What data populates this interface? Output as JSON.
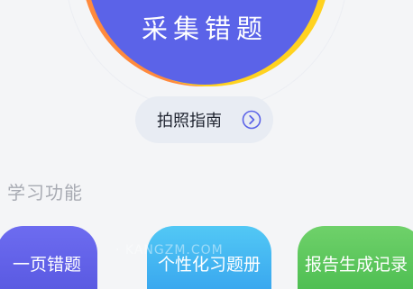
{
  "capture": {
    "label": "采集错题"
  },
  "guide": {
    "label": "拍照指南"
  },
  "section": {
    "title": "学习功能"
  },
  "features": [
    {
      "label": "一页错题",
      "color": "#5a5ae2"
    },
    {
      "label": "个性化习题册",
      "color": "#3aa8ef"
    },
    {
      "label": "报告生成记录",
      "color": "#4fbf53"
    }
  ],
  "watermark": {
    "text": "· KANGZM.COM"
  },
  "colors": {
    "accent": "#5b63e8",
    "ring_yellow": "#ffd21f",
    "ring_orange": "#ff8a3d"
  },
  "icons": {
    "guide_arrow": "chevron-right-circle-icon"
  }
}
